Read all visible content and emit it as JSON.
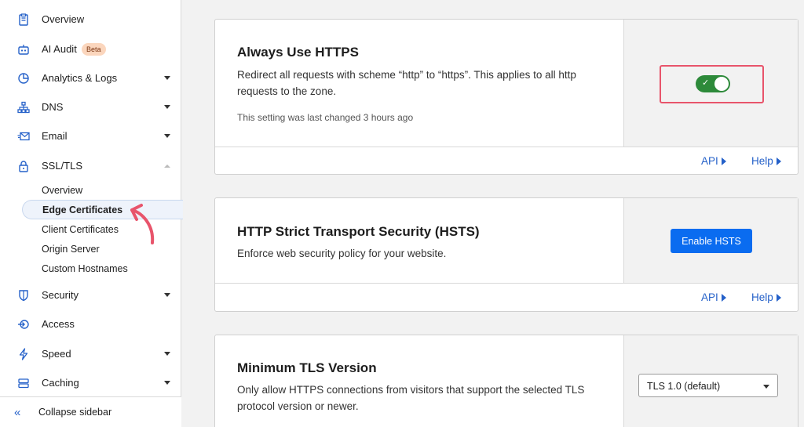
{
  "sidebar": {
    "items": [
      {
        "label": "Overview",
        "icon": "clipboard-icon"
      },
      {
        "label": "AI Audit",
        "icon": "robot-icon",
        "badge": "Beta"
      },
      {
        "label": "Analytics & Logs",
        "icon": "pie-chart-icon"
      },
      {
        "label": "DNS",
        "icon": "network-icon"
      },
      {
        "label": "Email",
        "icon": "envelope-icon"
      },
      {
        "label": "SSL/TLS",
        "icon": "lock-icon"
      },
      {
        "label": "Security",
        "icon": "shield-icon"
      },
      {
        "label": "Access",
        "icon": "access-icon"
      },
      {
        "label": "Speed",
        "icon": "lightning-icon"
      },
      {
        "label": "Caching",
        "icon": "server-icon"
      }
    ],
    "ssl_sub": [
      "Overview",
      "Edge Certificates",
      "Client Certificates",
      "Origin Server",
      "Custom Hostnames"
    ],
    "collapse_label": "Collapse sidebar",
    "collapse_icon": "«"
  },
  "cards": {
    "https": {
      "title": "Always Use HTTPS",
      "description": "Redirect all requests with scheme “http” to “https”. This applies to all http requests to the zone.",
      "meta": "This setting was last changed 3 hours ago",
      "toggle_on": true,
      "toggle_check": "✓",
      "api_label": "API",
      "help_label": "Help"
    },
    "hsts": {
      "title": "HTTP Strict Transport Security (HSTS)",
      "description": "Enforce web security policy for your website.",
      "button_label": "Enable HSTS",
      "api_label": "API",
      "help_label": "Help"
    },
    "tls": {
      "title": "Minimum TLS Version",
      "description": "Only allow HTTPS connections from visitors that support the selected TLS protocol version or newer.",
      "selected": "TLS 1.0 (default)"
    }
  },
  "colors": {
    "accent": "#2561c9",
    "primary_button": "#0a6cf0",
    "toggle_on": "#2d8a3a",
    "highlight": "#e8546b",
    "badge_bg": "#fbd6bd"
  }
}
